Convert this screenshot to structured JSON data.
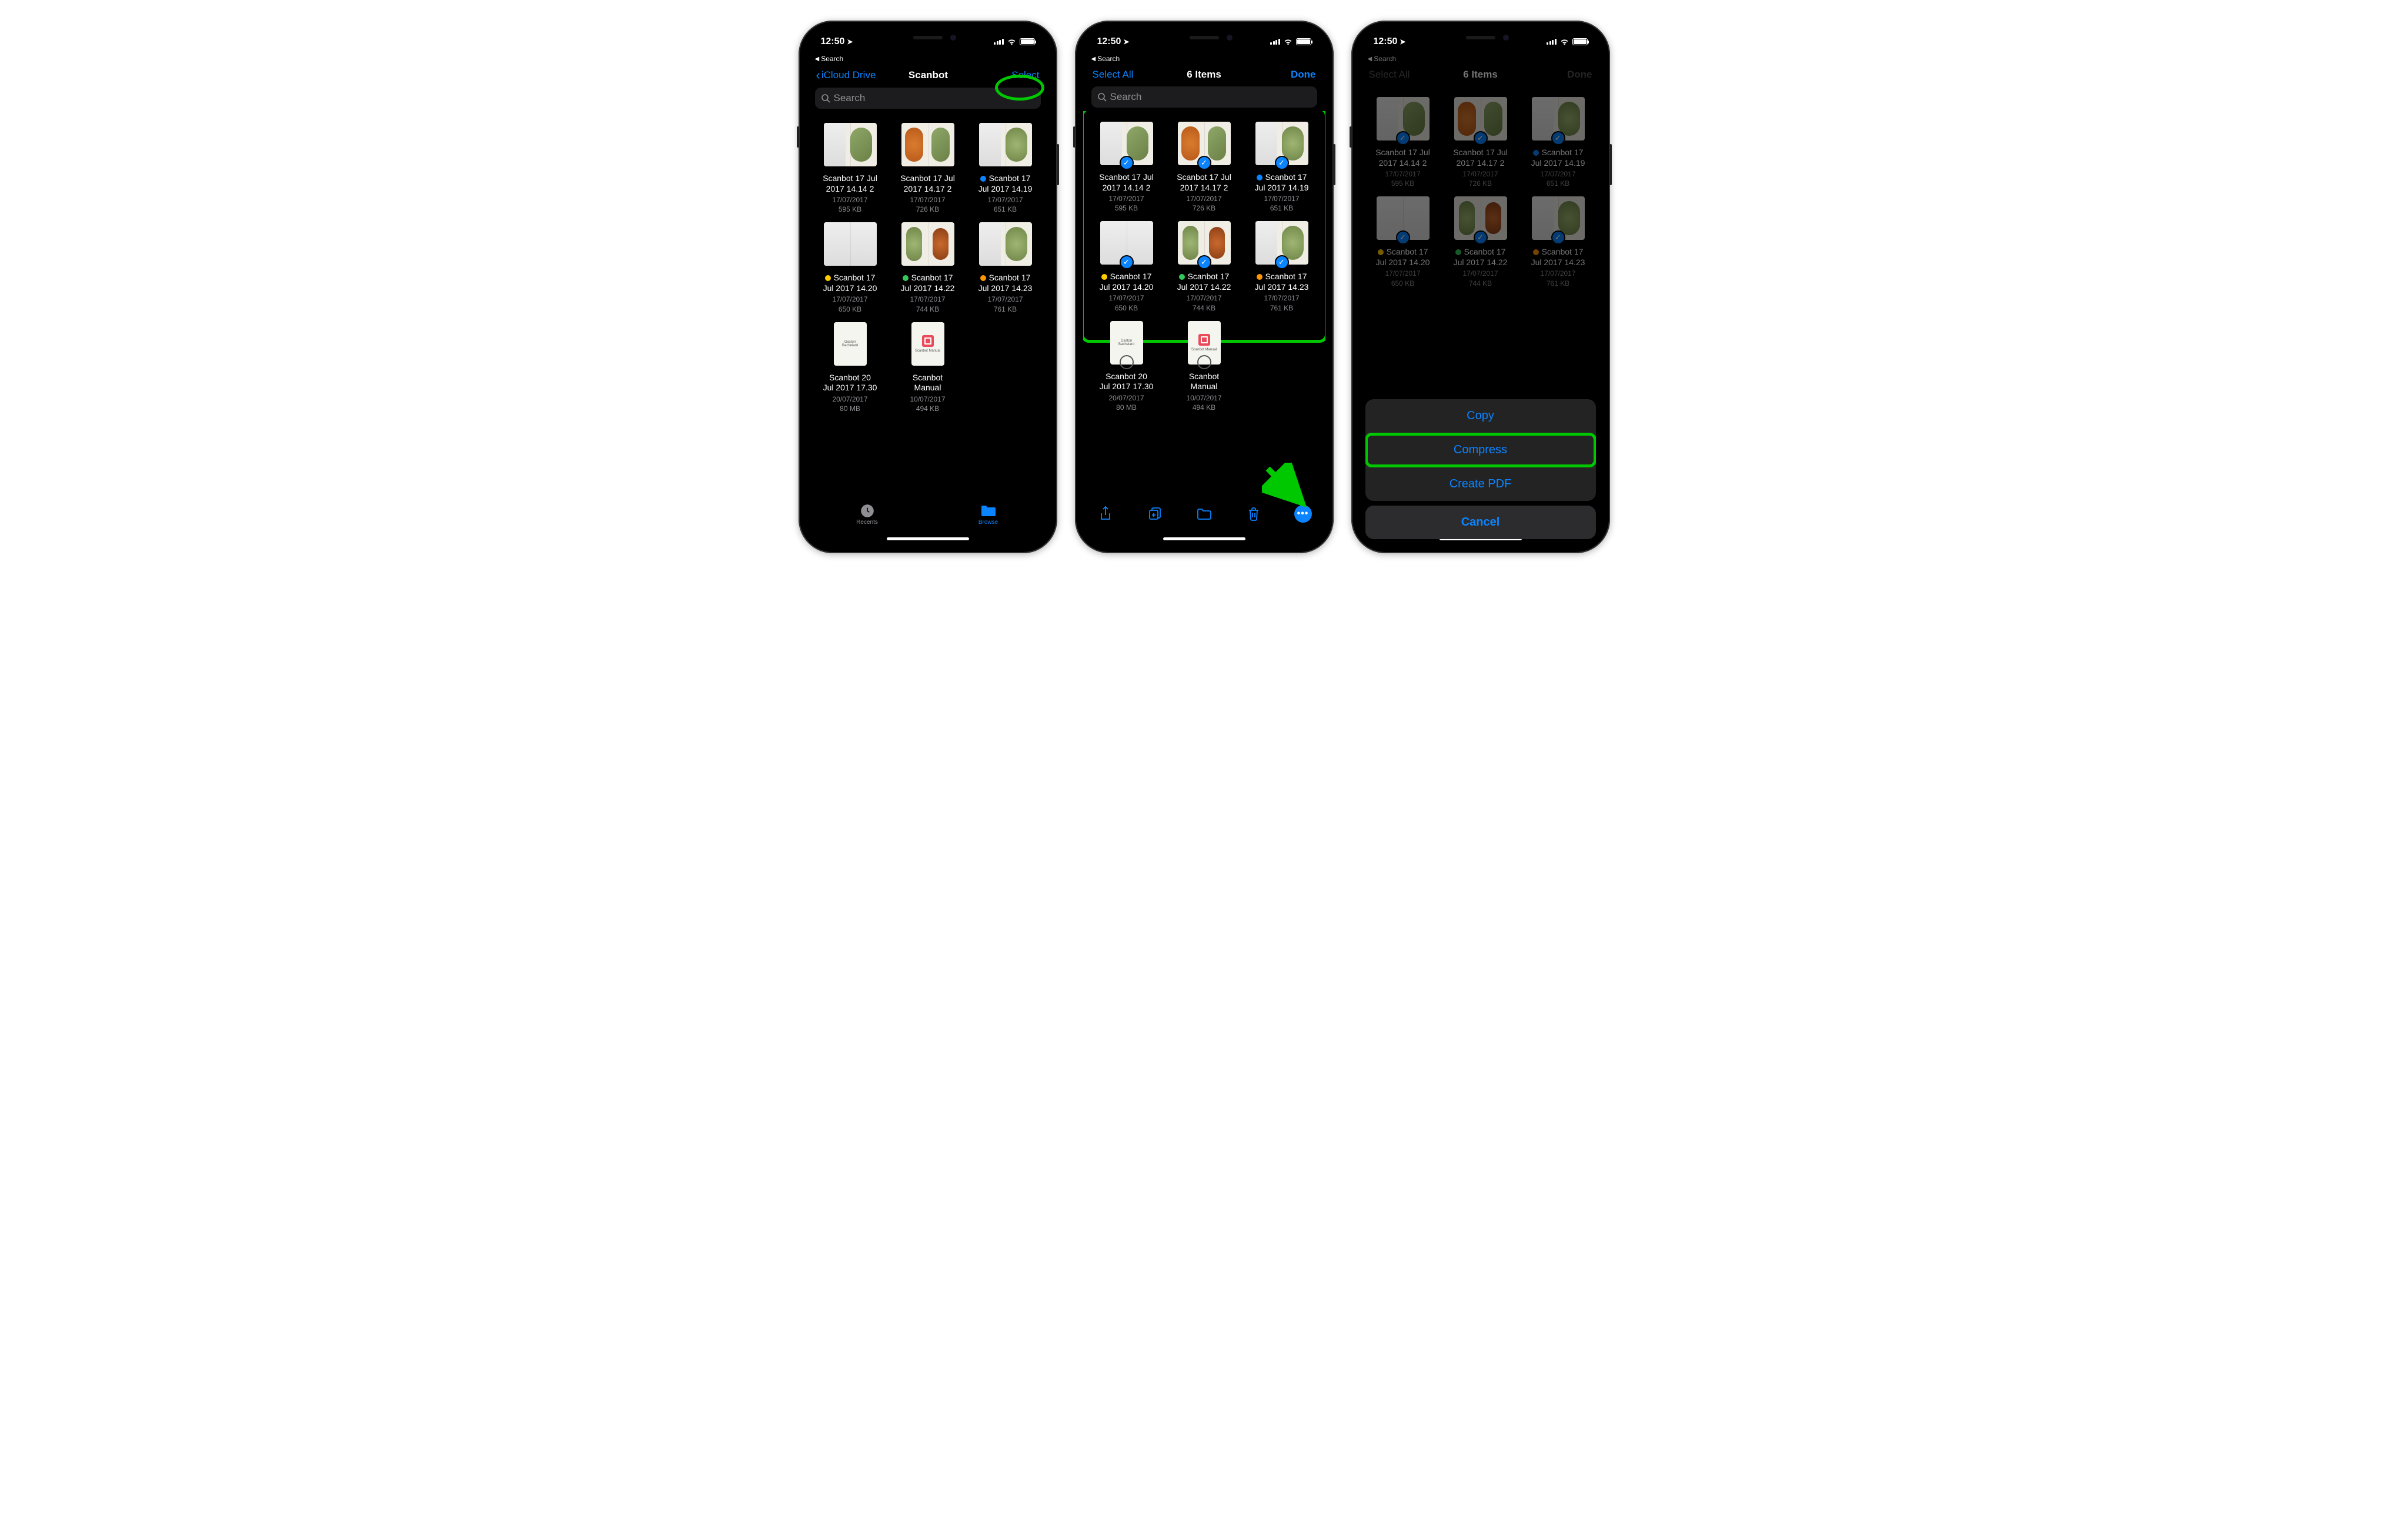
{
  "status": {
    "time": "12:50",
    "back_app": "Search"
  },
  "colors": {
    "accent": "#0b84ff",
    "highlight": "#00c800"
  },
  "phone1": {
    "nav": {
      "back": "iCloud Drive",
      "title": "Scanbot",
      "right": "Select"
    },
    "search_placeholder": "Search",
    "tabs": {
      "recents": "Recents",
      "browse": "Browse"
    }
  },
  "phone2": {
    "nav": {
      "left": "Select All",
      "title": "6 Items",
      "right": "Done"
    },
    "search_placeholder": "Search"
  },
  "phone3": {
    "nav": {
      "left": "Select All",
      "title": "6 Items",
      "right": "Done"
    },
    "actions": {
      "copy": "Copy",
      "compress": "Compress",
      "create_pdf": "Create PDF",
      "cancel": "Cancel"
    }
  },
  "files": [
    {
      "name1": "Scanbot 17 Jul",
      "name2": "2017 14.14 2",
      "date": "17/07/2017",
      "size": "595 KB",
      "tag": null
    },
    {
      "name1": "Scanbot 17 Jul",
      "name2": "2017 14.17 2",
      "date": "17/07/2017",
      "size": "726 KB",
      "tag": null
    },
    {
      "name1": "Scanbot 17",
      "name2": "Jul 2017 14.19",
      "date": "17/07/2017",
      "size": "651 KB",
      "tag": "#0b84ff"
    },
    {
      "name1": "Scanbot 17",
      "name2": "Jul 2017 14.20",
      "date": "17/07/2017",
      "size": "650 KB",
      "tag": "#ffcc00"
    },
    {
      "name1": "Scanbot 17",
      "name2": "Jul 2017 14.22",
      "date": "17/07/2017",
      "size": "744 KB",
      "tag": "#34c759"
    },
    {
      "name1": "Scanbot 17",
      "name2": "Jul 2017 14.23",
      "date": "17/07/2017",
      "size": "761 KB",
      "tag": "#ff9500"
    },
    {
      "name1": "Scanbot 20",
      "name2": "Jul 2017 17.30",
      "date": "20/07/2017",
      "size": "80 MB",
      "tag": null
    },
    {
      "name1": "Scanbot",
      "name2": "Manual",
      "date": "10/07/2017",
      "size": "494 KB",
      "tag": null
    }
  ]
}
